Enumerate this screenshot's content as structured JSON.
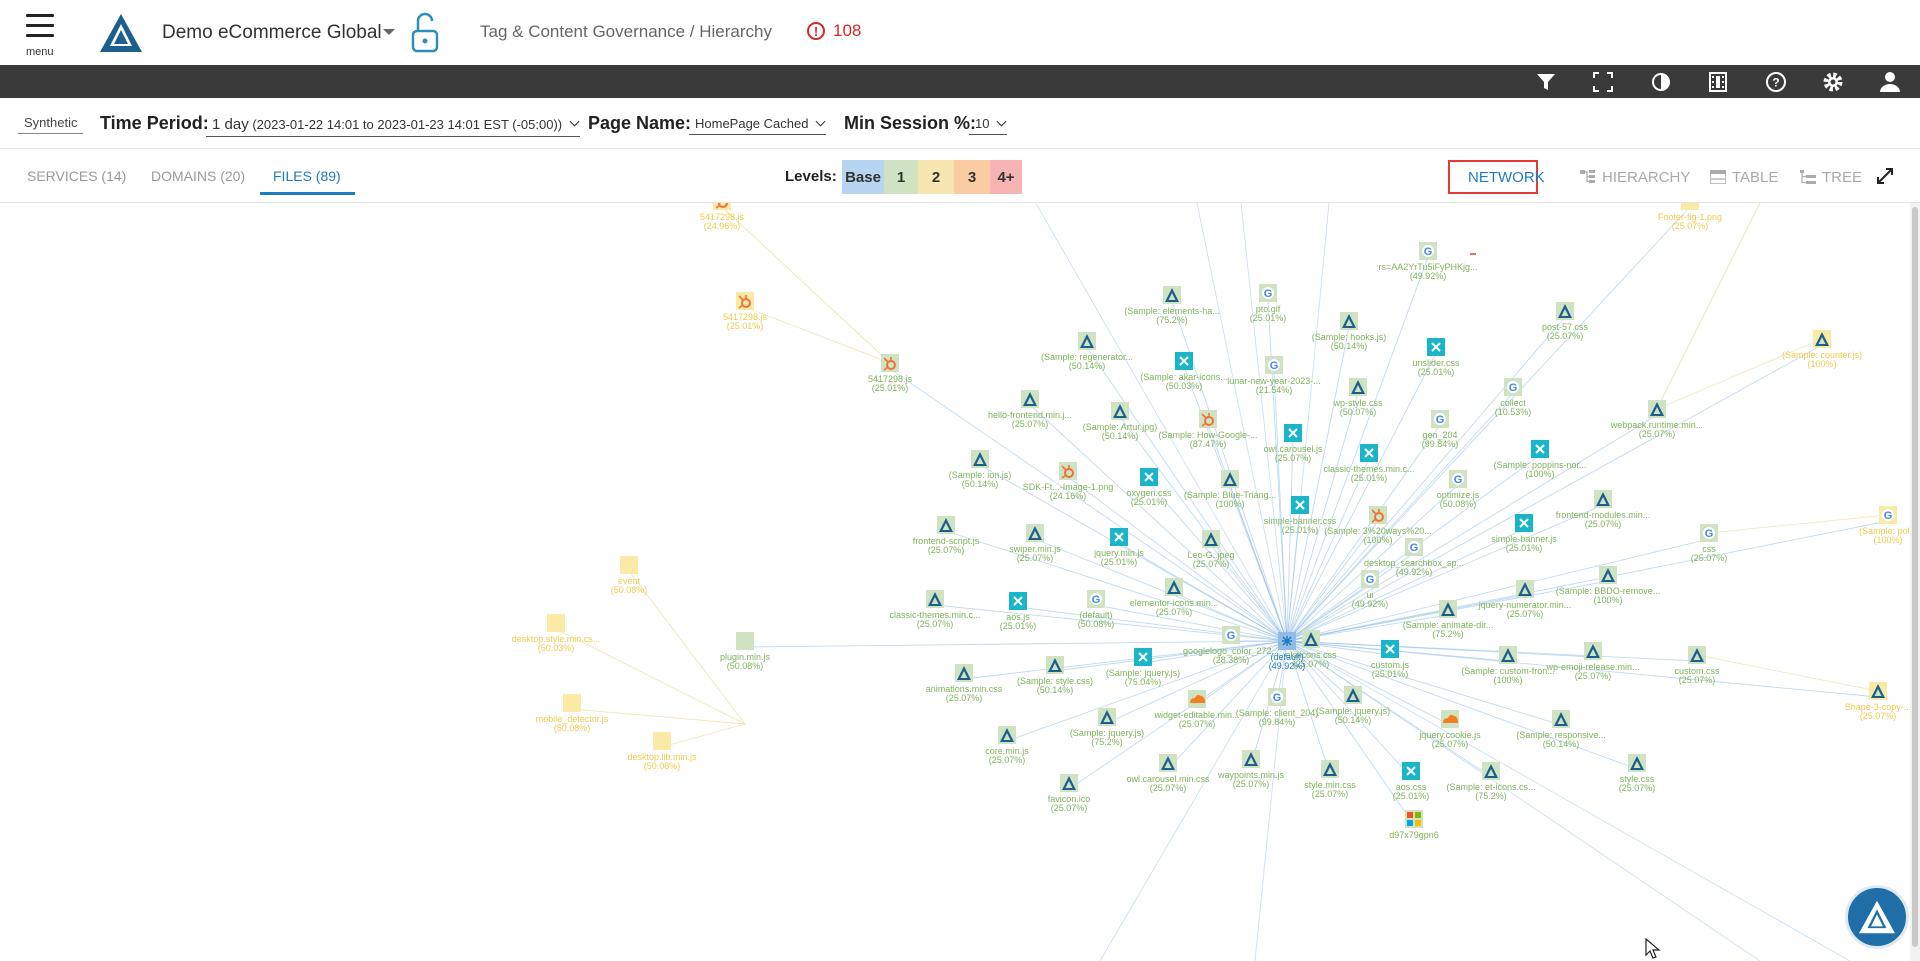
{
  "header": {
    "menu_label": "menu",
    "app_title": "Demo eCommerce Global",
    "breadcrumb": "Tag & Content Governance / Hierarchy",
    "alert_count": "108"
  },
  "toolbar": {
    "icons": [
      "filter-icon",
      "fullscreen-icon",
      "contrast-icon",
      "film-icon",
      "help-icon",
      "settings-icon",
      "user-icon"
    ]
  },
  "filters": {
    "mode": "Synthetic",
    "time_period_label": "Time Period:",
    "time_period_value": "1 day",
    "time_period_range": "(2023-01-22 14:01 to 2023-01-23 14:01 EST (-05:00))",
    "page_name_label": "Page Name:",
    "page_name_value": "HomePage Cached",
    "min_session_label": "Min Session %:",
    "min_session_value": "10"
  },
  "tabs": [
    {
      "label": "SERVICES (14)",
      "active": false
    },
    {
      "label": "DOMAINS (20)",
      "active": false
    },
    {
      "label": "FILES (89)",
      "active": true
    }
  ],
  "levels": {
    "label": "Levels:",
    "items": [
      {
        "label": "Base",
        "color": "#b7d4f0"
      },
      {
        "label": "1",
        "color": "#cfe3c2"
      },
      {
        "label": "2",
        "color": "#f7e6b0"
      },
      {
        "label": "3",
        "color": "#f9cda1"
      },
      {
        "label": "4+",
        "color": "#f5b3b3"
      }
    ]
  },
  "views": [
    {
      "label": "NETWORK",
      "active": true
    },
    {
      "label": "HIERARCHY",
      "active": false
    },
    {
      "label": "TABLE",
      "active": false
    },
    {
      "label": "TREE",
      "active": false
    }
  ],
  "graph": {
    "center": {
      "name": "(default)",
      "pct": "(49.92%)"
    },
    "nodes": [
      {
        "name": "5417298.js",
        "pct": "(24.96%)",
        "icon": "hubspot",
        "level": 2
      },
      {
        "name": "5417298.js",
        "pct": "(25.01%)",
        "icon": "hubspot",
        "level": 2
      },
      {
        "name": "5417298.js",
        "pct": "(25.01%)",
        "icon": "hubspot",
        "level": 1
      },
      {
        "name": "rs=AA2YrTu5iFyPHKjg...",
        "pct": "(49.92%)",
        "icon": "google",
        "level": 1
      },
      {
        "name": "Footer-fig-1.png",
        "pct": "(25.07%)",
        "icon": "none",
        "level": 2
      },
      {
        "name": "(Sample: elements-ha...",
        "pct": "(75.2%)",
        "icon": "catch",
        "level": 1
      },
      {
        "name": "pto.gif",
        "pct": "(25.01%)",
        "icon": "google-dash",
        "level": 1
      },
      {
        "name": "(Sample: hooks.js)",
        "pct": "(50.14%)",
        "icon": "catch",
        "level": 1
      },
      {
        "name": "post-57.css",
        "pct": "(25.07%)",
        "icon": "catch",
        "level": 1
      },
      {
        "name": "(Sample: counter.js)",
        "pct": "(100%)",
        "icon": "catch",
        "level": 2
      },
      {
        "name": "(Sample: regenerator...",
        "pct": "(50.14%)",
        "icon": "catch",
        "level": 1
      },
      {
        "name": "(Sample: akar-icons...",
        "pct": "(50.03%)",
        "icon": "teal",
        "level": 1
      },
      {
        "name": "lunar-new-year-2023-...",
        "pct": "(21.54%)",
        "icon": "google",
        "level": 1
      },
      {
        "name": "unslider.css",
        "pct": "(25.01%)",
        "icon": "teal",
        "level": 1
      },
      {
        "name": "wp-style.css",
        "pct": "(50.07%)",
        "icon": "catch",
        "level": 1
      },
      {
        "name": "collect",
        "pct": "(10.53%)",
        "icon": "google",
        "level": 1
      },
      {
        "name": "webpack.runtime.min...",
        "pct": "(25.07%)",
        "icon": "catch",
        "level": 1
      },
      {
        "name": "hello-frontend.min.j...",
        "pct": "(25.07%)",
        "icon": "catch",
        "level": 1
      },
      {
        "name": "(Sample: Artur.jpg)",
        "pct": "(50.14%)",
        "icon": "catch",
        "level": 1
      },
      {
        "name": "(Sample: How-Google-...",
        "pct": "(87.47%)",
        "icon": "hubspot",
        "level": 1
      },
      {
        "name": "owl.carousel.js",
        "pct": "(25.07%)",
        "icon": "teal",
        "level": 1
      },
      {
        "name": "gen_204",
        "pct": "(99.84%)",
        "icon": "google",
        "level": 1
      },
      {
        "name": "classic-themes.min.c...",
        "pct": "(25.01%)",
        "icon": "teal",
        "level": 1
      },
      {
        "name": "(Sample: poppins-nor...",
        "pct": "(100%)",
        "icon": "teal",
        "level": 1
      },
      {
        "name": "(Sample: ion.js)",
        "pct": "(50.14%)",
        "icon": "catch",
        "level": 1
      },
      {
        "name": "SDK-Ft...-Image-1.png",
        "pct": "(24.16%)",
        "icon": "hubspot",
        "level": 1
      },
      {
        "name": "oxygen.css",
        "pct": "(25.01%)",
        "icon": "teal",
        "level": 1
      },
      {
        "name": "(Sample: Blue-Triang...",
        "pct": "(100%)",
        "icon": "catch",
        "level": 1
      },
      {
        "name": "optimize.js",
        "pct": "(50.08%)",
        "icon": "google",
        "level": 1
      },
      {
        "name": "frontend-modules.min...",
        "pct": "(25.07%)",
        "icon": "catch",
        "level": 1
      },
      {
        "name": "simple-banner.css",
        "pct": "(25.01%)",
        "icon": "teal",
        "level": 1
      },
      {
        "name": "(Sample: 3%20ways%20...",
        "pct": "(100%)",
        "icon": "hubspot",
        "level": 1
      },
      {
        "name": "simple-banner.js",
        "pct": "(25.01%)",
        "icon": "teal",
        "level": 1
      },
      {
        "name": "css",
        "pct": "(25.07%)",
        "icon": "google",
        "level": 1
      },
      {
        "name": "(Sample: pol...",
        "pct": "(100%)",
        "icon": "google",
        "level": 2
      },
      {
        "name": "frontend-script.js",
        "pct": "(25.07%)",
        "icon": "catch",
        "level": 1
      },
      {
        "name": "swiper.min.js",
        "pct": "(25.07%)",
        "icon": "catch",
        "level": 1
      },
      {
        "name": "jquery.min.js",
        "pct": "(25.01%)",
        "icon": "teal",
        "level": 1
      },
      {
        "name": "Leo-G..jpeg",
        "pct": "(25.07%)",
        "icon": "catch",
        "level": 1
      },
      {
        "name": "desktop_searchbox_sp...",
        "pct": "(49.92%)",
        "icon": "google",
        "level": 1
      },
      {
        "name": "event",
        "pct": "(50.08%)",
        "icon": "none",
        "level": 2
      },
      {
        "name": "ui",
        "pct": "(49.92%)",
        "icon": "google",
        "level": 1
      },
      {
        "name": "jquery-numerator.min...",
        "pct": "(25.07%)",
        "icon": "catch",
        "level": 1
      },
      {
        "name": "(Sample: BBDO-remove...",
        "pct": "(100%)",
        "icon": "catch",
        "level": 1
      },
      {
        "name": "classic-themes.min.c...",
        "pct": "(25.07%)",
        "icon": "catch",
        "level": 1
      },
      {
        "name": "aos.js",
        "pct": "(25.01%)",
        "icon": "teal",
        "level": 1
      },
      {
        "name": "(default)",
        "pct": "(50.08%)",
        "icon": "google",
        "level": 1
      },
      {
        "name": "elementor-icons.min...",
        "pct": "(25.07%)",
        "icon": "catch",
        "level": 1
      },
      {
        "name": "(Sample: animate-dir...",
        "pct": "(75.2%)",
        "icon": "catch",
        "level": 1
      },
      {
        "name": "desktop.style.min.cs...",
        "pct": "(50.03%)",
        "icon": "none",
        "level": 2
      },
      {
        "name": "plugin.min.js",
        "pct": "(50.08%)",
        "icon": "none",
        "level": 1
      },
      {
        "name": "googlelogo_color_272...",
        "pct": "(28.38%)",
        "icon": "google",
        "level": 1
      },
      {
        "name": "ekiticons.css",
        "pct": "(25.07%)",
        "icon": "catch",
        "level": 1
      },
      {
        "name": "custom.js",
        "pct": "(25.01%)",
        "icon": "teal",
        "level": 1
      },
      {
        "name": "(Sample: custom-fron...",
        "pct": "(100%)",
        "icon": "catch",
        "level": 1
      },
      {
        "name": "wp-emoji-release.min...",
        "pct": "(25.07%)",
        "icon": "catch",
        "level": 1
      },
      {
        "name": "custom.css",
        "pct": "(25.07%)",
        "icon": "catch",
        "level": 1
      },
      {
        "name": "Shape-3-copy-...",
        "pct": "(25.07%)",
        "icon": "catch",
        "level": 2
      },
      {
        "name": "animations.min.css",
        "pct": "(25.07%)",
        "icon": "catch",
        "level": 1
      },
      {
        "name": "(Sample: style.css)",
        "pct": "(50.14%)",
        "icon": "catch",
        "level": 1
      },
      {
        "name": "(Sample: jquery.js)",
        "pct": "(75.04%)",
        "icon": "teal",
        "level": 1
      },
      {
        "name": "mobile_detector.js",
        "pct": "(50.08%)",
        "icon": "none",
        "level": 2
      },
      {
        "name": "widget-editable.min...",
        "pct": "(25.07%)",
        "icon": "cloudflare",
        "level": 1
      },
      {
        "name": "(Sample: client_204)",
        "pct": "(99.84%)",
        "icon": "google",
        "level": 1
      },
      {
        "name": "(Sample: jquery.js)",
        "pct": "(50.14%)",
        "icon": "catch",
        "level": 1
      },
      {
        "name": "jquery.cookie.js",
        "pct": "(25.07%)",
        "icon": "cloudflare",
        "level": 1
      },
      {
        "name": "(Sample: responsive...",
        "pct": "(50.14%)",
        "icon": "catch",
        "level": 1
      },
      {
        "name": "(Sample: jquery.js)",
        "pct": "(75.2%)",
        "icon": "catch",
        "level": 1
      },
      {
        "name": "desktop.lib.min.js",
        "pct": "(50.08%)",
        "icon": "none",
        "level": 2
      },
      {
        "name": "core.min.js",
        "pct": "(25.07%)",
        "icon": "catch",
        "level": 1
      },
      {
        "name": "owl.carousel.min.css",
        "pct": "(25.07%)",
        "icon": "catch",
        "level": 1
      },
      {
        "name": "waypoints.min.js",
        "pct": "(25.07%)",
        "icon": "catch",
        "level": 1
      },
      {
        "name": "style.min.css",
        "pct": "(25.07%)",
        "icon": "catch",
        "level": 1
      },
      {
        "name": "aos.css",
        "pct": "(25.01%)",
        "icon": "teal",
        "level": 1
      },
      {
        "name": "(Sample: et-icons.cs...",
        "pct": "(75.2%)",
        "icon": "catch",
        "level": 1
      },
      {
        "name": "style.css",
        "pct": "(25.07%)",
        "icon": "catch",
        "level": 1
      },
      {
        "name": "favicon.ico",
        "pct": "(25.07%)",
        "icon": "catch",
        "level": 1
      },
      {
        "name": "d97x79gpn6",
        "pct": "",
        "icon": "microsoft",
        "level": 1
      }
    ]
  }
}
